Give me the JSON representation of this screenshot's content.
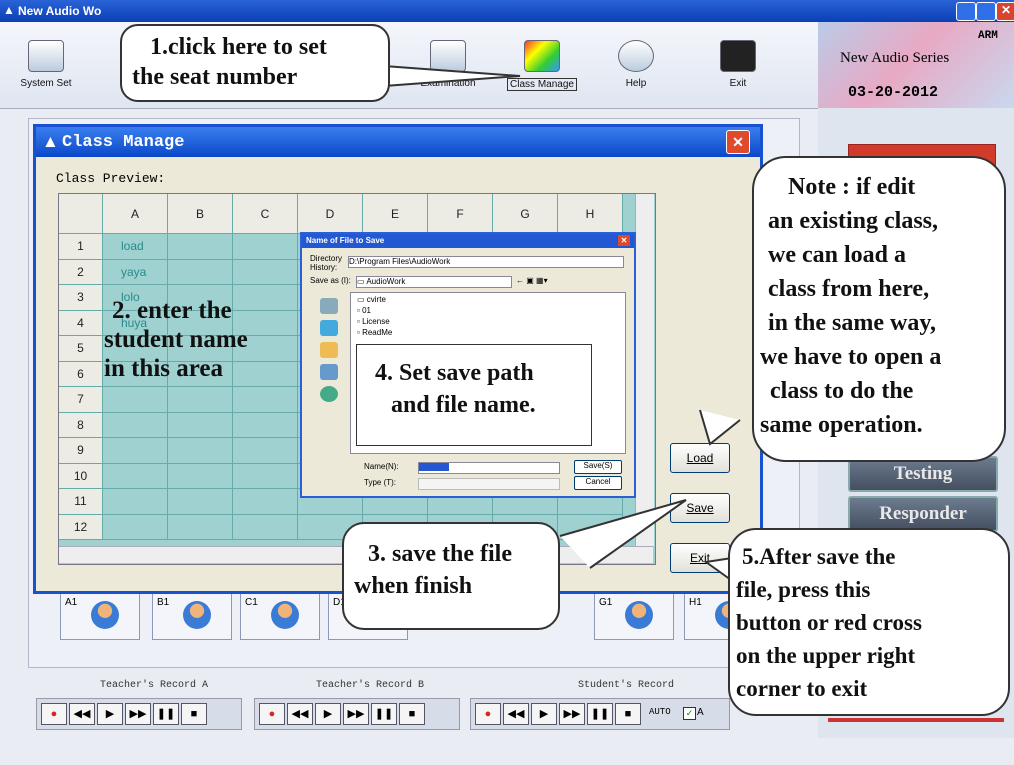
{
  "window": {
    "title": "New Audio Wo"
  },
  "toolbar": {
    "system_set": "System Set",
    "examination": "Examination",
    "class_manage": "Class Manage",
    "help": "Help",
    "exit": "Exit"
  },
  "brand": {
    "arm": "ARM",
    "series": "New Audio Series",
    "date": "03-20-2012"
  },
  "right_panel": {
    "testing": "Testing",
    "responder": "Responder"
  },
  "dialog": {
    "title": "Class Manage",
    "preview_label": "Class Preview:",
    "columns": [
      "A",
      "B",
      "C",
      "D",
      "E",
      "F",
      "G",
      "H"
    ],
    "rows": [
      "1",
      "2",
      "3",
      "4",
      "5",
      "6",
      "7",
      "8",
      "9",
      "10",
      "11",
      "12"
    ],
    "names": [
      "load",
      "yaya",
      "lolo",
      "huya"
    ],
    "load_btn": "Load",
    "save_btn": "Save",
    "exit_btn": "Exit"
  },
  "save_dialog": {
    "title": "Name of File to Save",
    "directory_label": "Directory History:",
    "directory": "D:\\Program Files\\AudioWork",
    "save_as_label": "Save as (I):",
    "folder": "AudioWork",
    "files": [
      "cvirte",
      "01",
      "License",
      "ReadMe"
    ],
    "name_label": "Name(N):",
    "type_label": "Type (T):",
    "save_btn": "Save(S)",
    "cancel_btn": "Cancel"
  },
  "seats": [
    "A1",
    "B1",
    "C1",
    "D1",
    "G1",
    "H1"
  ],
  "recorder": {
    "teacher_a": "Teacher's Record A",
    "teacher_b": "Teacher's Record B",
    "student": "Student's Record",
    "auto": "AUTO",
    "a": "A"
  },
  "callouts": {
    "c1_line1": "1.click here to set",
    "c1_line2": "the seat number",
    "c2_line1": "2. enter the",
    "c2_line2": "student name",
    "c2_line3": "in this area",
    "c3_line1": "3. save the file",
    "c3_line2": "when finish",
    "c4_line1": "4. Set save path",
    "c4_line2": "and file name.",
    "c5_line1": "5.After save the",
    "c5_line2": "file, press this",
    "c5_line3": "button or red cross",
    "c5_line4": "on the upper right",
    "c5_line5": "corner to exit",
    "note_line1": "Note : if edit",
    "note_line2": "an existing class,",
    "note_line3": "we can load a",
    "note_line4": "class from here,",
    "note_line5": "in the same way,",
    "note_line6": "we have to open a",
    "note_line7": "class to do the",
    "note_line8": "same operation."
  }
}
